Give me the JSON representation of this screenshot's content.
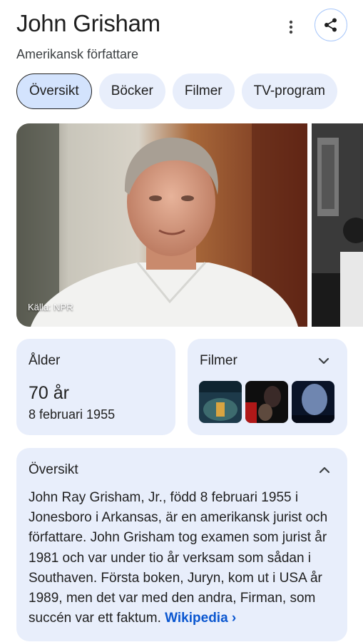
{
  "header": {
    "title": "John Grisham",
    "subtitle": "Amerikansk författare",
    "more_icon": "more-vert-icon",
    "share_icon": "share-icon"
  },
  "tabs": [
    {
      "label": "Översikt",
      "active": true
    },
    {
      "label": "Böcker",
      "active": false
    },
    {
      "label": "Filmer",
      "active": false
    },
    {
      "label": "TV-program",
      "active": false
    }
  ],
  "gallery": {
    "credit": "Källa: NPR"
  },
  "age_card": {
    "label": "Ålder",
    "value": "70 år",
    "date": "8 februari 1955"
  },
  "films_card": {
    "label": "Filmer",
    "expand_icon": "chevron-down-icon"
  },
  "overview": {
    "title": "Översikt",
    "collapse_icon": "chevron-up-icon",
    "text": "John Ray Grisham, Jr., född 8 februari 1955 i Jonesboro i Arkansas, är en amerikansk jurist och författare. John Grisham tog examen som jurist år 1981 och var under tio år verksam som sådan i Southaven. Första boken, Juryn, kom ut i USA år 1989, men det var med den andra, Firman, som succén var ett faktum.",
    "link": "Wikipedia ›"
  },
  "colors": {
    "card_bg": "#e8eefb",
    "chip_active_bg": "#d3e3fd",
    "link": "#0b57d0"
  }
}
